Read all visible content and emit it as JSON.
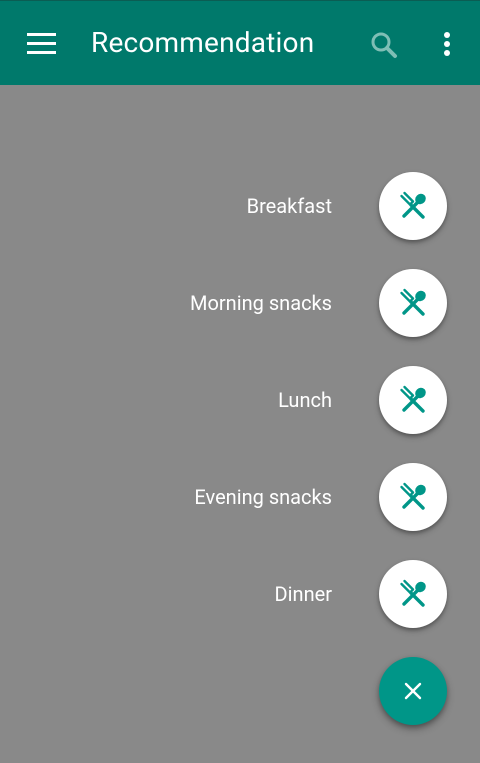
{
  "toolbar": {
    "title": "Recommendation",
    "menu_icon": "hamburger-menu-icon",
    "search_icon": "search-icon",
    "more_icon": "overflow-more-icon"
  },
  "meal_menu": {
    "items": [
      {
        "label": "Breakfast",
        "icon": "fork-spoon-icon"
      },
      {
        "label": "Morning snacks",
        "icon": "fork-spoon-icon"
      },
      {
        "label": "Lunch",
        "icon": "fork-spoon-icon"
      },
      {
        "label": "Evening snacks",
        "icon": "fork-spoon-icon"
      },
      {
        "label": "Dinner",
        "icon": "fork-spoon-icon"
      }
    ],
    "close_icon": "close-icon"
  },
  "colors": {
    "primary": "#00796b",
    "accent": "#009688",
    "scrim": "#898989",
    "icon_tint": "#009688"
  }
}
